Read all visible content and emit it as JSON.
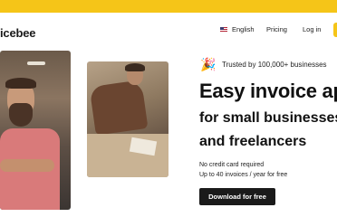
{
  "header": {
    "logo_text": "icebee",
    "nav": {
      "language": "English",
      "language_flag_icon": "us-flag-icon",
      "pricing": "Pricing",
      "login": "Log in"
    }
  },
  "colors": {
    "accent": "#f5c518",
    "text": "#111111",
    "cta_background": "#1a1a1a"
  },
  "hero": {
    "trusted_icon": "party-popper-icon",
    "trusted_text": "Trusted by 100,000+ businesses",
    "headline_line1": "Easy invoice ap",
    "headline_line2": "for small businesses",
    "headline_line3": "and freelancers",
    "note_1": "No credit card required",
    "note_2": "Up to 40 invoices / year for free",
    "cta_label": "Download for free"
  }
}
